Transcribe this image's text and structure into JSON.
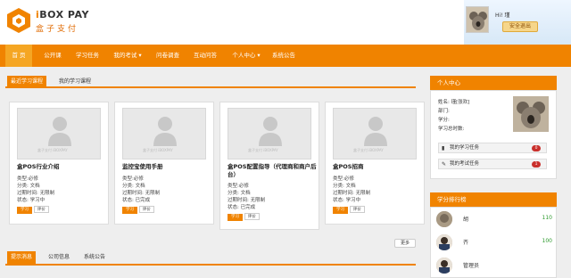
{
  "brand": {
    "name_prefix": "i",
    "name_rest": "BOX PAY",
    "name_cn": "盒子支付"
  },
  "user": {
    "greeting": "Hi!",
    "name": "瑾",
    "logout_label": "安全退出"
  },
  "nav": {
    "items": [
      "首  页",
      "公开课",
      "学习任务",
      "我的考试 ▾",
      "问卷调查",
      "互动问答",
      "个人中心 ▾",
      "系统公告"
    ],
    "active_index": 0
  },
  "course_tabs": [
    "最近学习课程",
    "我的学习课程"
  ],
  "courses": [
    {
      "title": "盒POS行业介绍",
      "type": "类型:必修",
      "category": "分类: 文档",
      "expiry": "过期时间: 无限制",
      "status": "状态: 学习中",
      "btn_learn": "学习",
      "btn_eval": "评价"
    },
    {
      "title": "监控宝使用手册",
      "type": "类型:必修",
      "category": "分类: 文档",
      "expiry": "过期时间: 无限制",
      "status": "状态: 已完成",
      "btn_learn": "学习",
      "btn_eval": "评价"
    },
    {
      "title": "盒POS配置指导（代理商和商户后台）",
      "type": "类型:必修",
      "category": "分类: 文档",
      "expiry": "过期时间: 无限制",
      "status": "状态: 已完成",
      "btn_learn": "学习",
      "btn_eval": "评价"
    },
    {
      "title": "盒POS招商",
      "type": "类型:必修",
      "category": "分类: 文档",
      "expiry": "过期时间: 无限制",
      "status": "状态: 学习中",
      "btn_learn": "学习",
      "btn_eval": "评价"
    }
  ],
  "more_label": "更多",
  "bottom_tabs": [
    "提示消息",
    "公司信息",
    "系统公告"
  ],
  "personal": {
    "title": "个人中心",
    "name_line": "姓名:        瑾[张欢]",
    "dept_line": "部门:",
    "credit_line": "学分:",
    "hours_line": "学习总时数:",
    "task_label": "我的学习任务",
    "task_count": "0",
    "exam_label": "我的考试任务",
    "exam_count": "1"
  },
  "ranking": {
    "title": "学分排行榜",
    "rows": [
      {
        "name": "胡",
        "score": "110"
      },
      {
        "name": "齐",
        "score": "100"
      },
      {
        "name": "管理员",
        "score": ""
      }
    ]
  },
  "colors": {
    "accent": "#f08300",
    "badge": "#c9302c",
    "score": "#2e9a2e"
  }
}
